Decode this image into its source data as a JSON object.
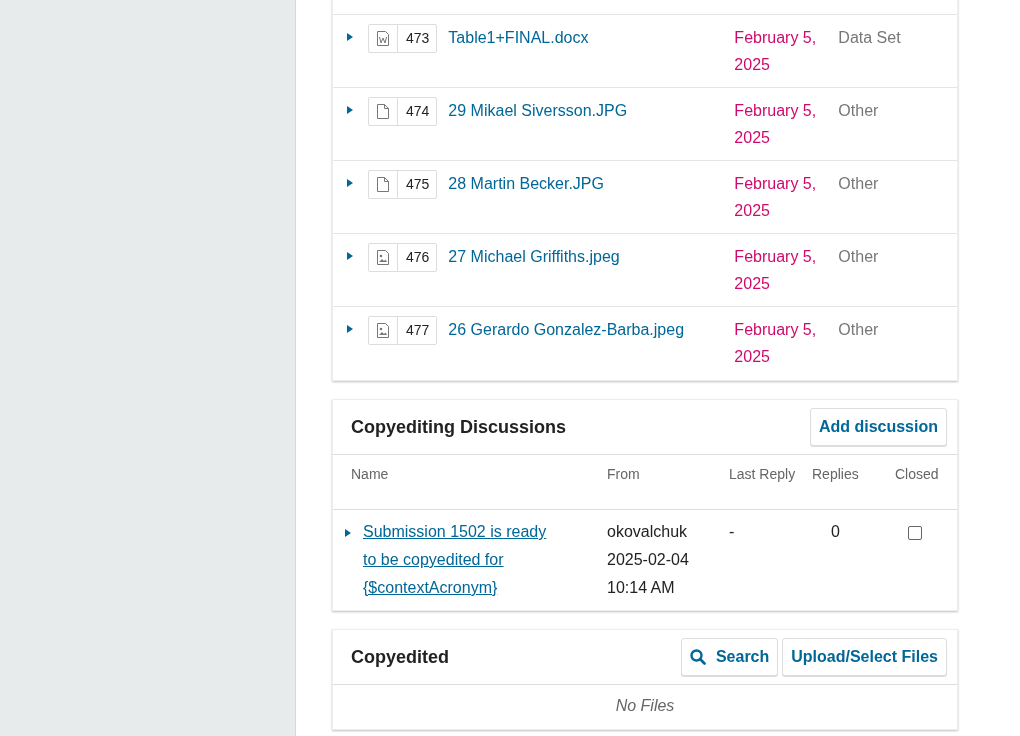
{
  "files": [
    {
      "kind": "word",
      "id": "473",
      "name": "Table1+FINAL.docx",
      "date": "February 5, 2025",
      "type": "Data Set"
    },
    {
      "kind": "file",
      "id": "474",
      "name": "29 Mikael Siversson.JPG",
      "date": "February 5, 2025",
      "type": "Other"
    },
    {
      "kind": "file",
      "id": "475",
      "name": "28 Martin Becker.JPG",
      "date": "February 5, 2025",
      "type": "Other"
    },
    {
      "kind": "image",
      "id": "476",
      "name": "27 Michael Griffiths.jpeg",
      "date": "February 5, 2025",
      "type": "Other"
    },
    {
      "kind": "image",
      "id": "477",
      "name": "26 Gerardo Gonzalez-Barba.jpeg",
      "date": "February 5, 2025",
      "type": "Other"
    }
  ],
  "discussions": {
    "title": "Copyediting Discussions",
    "add_button": "Add discussion",
    "columns": [
      "Name",
      "From",
      "Last Reply",
      "Replies",
      "Closed"
    ],
    "rows": [
      {
        "name": "Submission 1502 is ready to be copyedited for {$contextAcronym}",
        "from_user": "okovalchuk",
        "from_date": "2025-02-04",
        "from_time": "10:14 AM",
        "last_reply": "-",
        "replies": "0",
        "closed": false
      }
    ]
  },
  "copyedited": {
    "title": "Copyedited",
    "search_button": "Search",
    "upload_button": "Upload/Select Files",
    "empty": "No Files"
  }
}
